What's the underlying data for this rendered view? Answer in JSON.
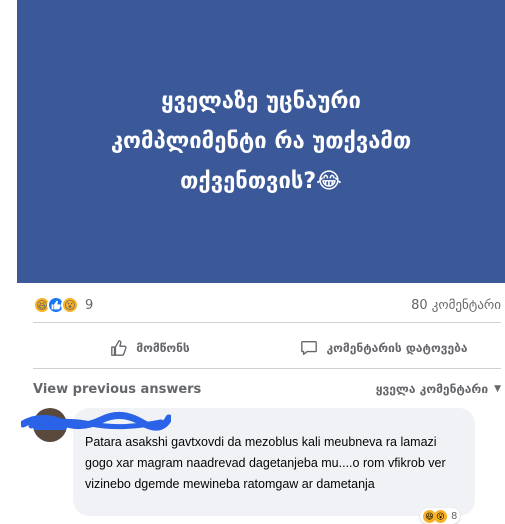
{
  "post": {
    "image_lines": [
      "ყველაზე უცნაური",
      "კომპლიმენტი რა უთქვამთ",
      "თქვენთვის?😂"
    ],
    "image_bg": "#3b5998",
    "reactions": {
      "icons": [
        "haha",
        "like",
        "wow"
      ],
      "count": "9"
    },
    "comment_count": "80 კომენტარი"
  },
  "actions": {
    "like_label": "მომწონს",
    "comment_label": "კომენტარის დატოვება"
  },
  "comments": {
    "view_previous": "View previous answers",
    "sort_label": "ყველა კომენტარი",
    "items": [
      {
        "text": "Patara asakshi gavtxovdi da mezoblus kali meubneva ra lamazi gogo xar magram naadrevad dagetanjeba mu....o rom vfikrob ver vizinebo dgemde mewineba ratomgaw ar dametanja",
        "reaction_count": "8"
      }
    ]
  }
}
